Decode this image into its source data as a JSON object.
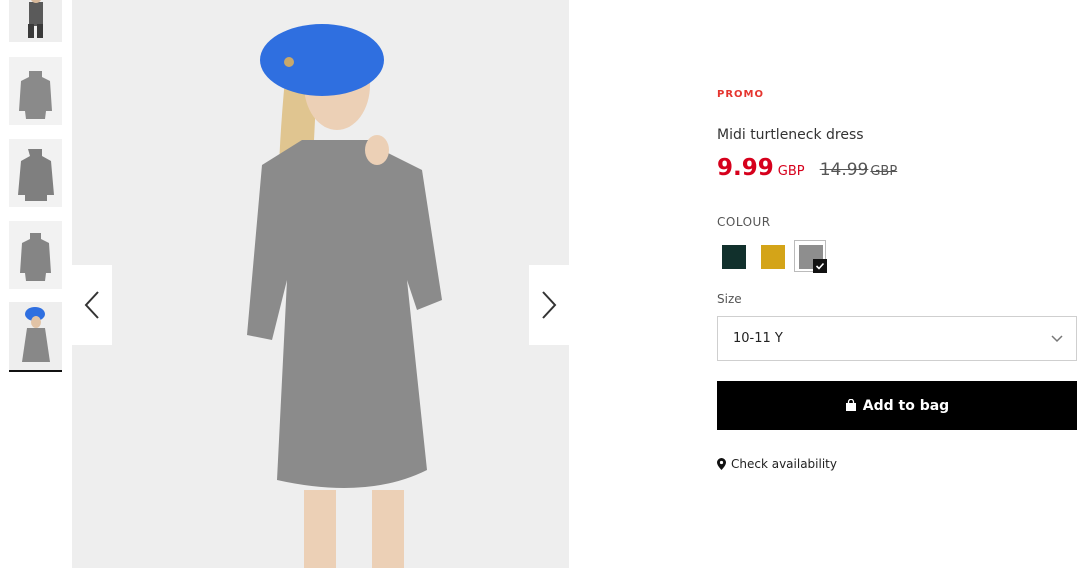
{
  "product": {
    "promo_label": "PROMO",
    "title": "Midi turtleneck dress",
    "price_current": "9.99",
    "price_current_currency": "GBP",
    "price_original": "14.99",
    "price_original_currency": "GBP"
  },
  "colour": {
    "label": "COLOUR",
    "swatches": [
      {
        "name": "dark-green",
        "color": "#11302c",
        "selected": false
      },
      {
        "name": "mustard",
        "color": "#d4a418",
        "selected": false
      },
      {
        "name": "grey-melange",
        "color": "#8e8e8e",
        "selected": true
      }
    ]
  },
  "size": {
    "label": "Size",
    "selected": "10-11 Y"
  },
  "actions": {
    "add_to_bag": "Add to bag",
    "check_availability": "Check availability"
  },
  "gallery": {
    "thumbnail_count": 5,
    "active_index": 4
  },
  "colors": {
    "sale_red": "#d6001c",
    "promo_red": "#e5352f",
    "button_black": "#000000"
  }
}
